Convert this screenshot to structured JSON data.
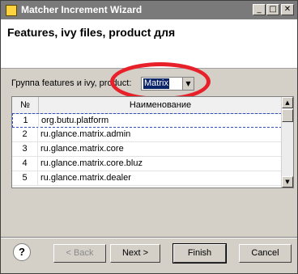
{
  "window": {
    "title": "Matcher Increment Wizard",
    "controls": {
      "minimize": "_",
      "maximize": "□",
      "close": "✕"
    }
  },
  "header": {
    "title": "Features, ivy files, product для"
  },
  "group": {
    "label": "Группа features и ivy, product:",
    "selected": "Matrix"
  },
  "table": {
    "columns": [
      "№",
      "Наименование"
    ],
    "rows": [
      {
        "num": "1",
        "name": "org.butu.platform"
      },
      {
        "num": "2",
        "name": "ru.glance.matrix.admin"
      },
      {
        "num": "3",
        "name": "ru.glance.matrix.core"
      },
      {
        "num": "4",
        "name": "ru.glance.matrix.core.bluz"
      },
      {
        "num": "5",
        "name": "ru.glance.matrix.dealer"
      }
    ]
  },
  "footer": {
    "help": "?",
    "back": "< Back",
    "next": "Next >",
    "finish": "Finish",
    "cancel": "Cancel"
  },
  "colors": {
    "titlebar": "#7a7a7a",
    "selection": "#0a246a",
    "annotation": "#e8202a"
  }
}
